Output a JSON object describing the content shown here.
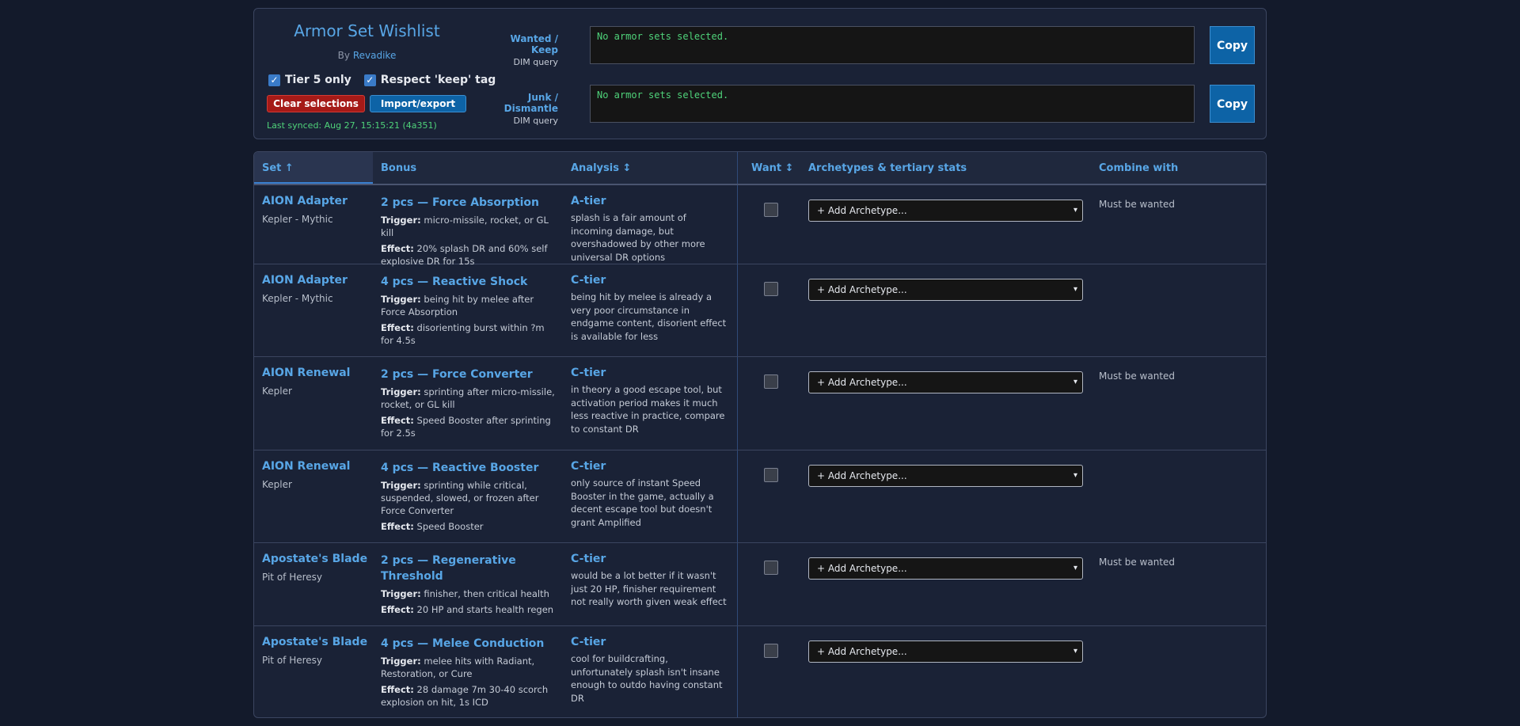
{
  "header": {
    "title": "Armor Set Wishlist",
    "by_prefix": "By",
    "author": "Revadike",
    "tier5_label": "Tier 5 only",
    "keep_label": "Respect 'keep' tag",
    "clear_label": "Clear selections",
    "import_label": "Import/export",
    "synced": "Last synced: Aug 27, 15:15:21 (4a351)"
  },
  "queries": {
    "wanted_label": "Wanted / Keep",
    "wanted_sub": "DIM query",
    "wanted_value": "No armor sets selected.",
    "junk_label": "Junk / Dismantle",
    "junk_sub": "DIM query",
    "junk_value": "No armor sets selected.",
    "copy_label": "Copy"
  },
  "columns": {
    "set": "Set ↑",
    "bonus": "Bonus",
    "analysis": "Analysis ↕",
    "want": "Want ↕",
    "archetypes": "Archetypes & tertiary stats",
    "combine": "Combine with"
  },
  "select_label": "+ Add Archetype...",
  "rows": [
    {
      "set": "AION Adapter",
      "source": "Kepler - Mythic",
      "bonus": "2 pcs — Force Absorption",
      "trigger_label": "Trigger:",
      "trigger": "micro-missile, rocket, or GL kill",
      "effect_label": "Effect:",
      "effect": "20% splash DR and 60% self explosive DR for 15s",
      "tier": "A-tier",
      "analysis": "splash is a fair amount of incoming damage, but overshadowed by other more universal DR options",
      "combine": "Must be wanted"
    },
    {
      "set": "AION Adapter",
      "source": "Kepler - Mythic",
      "bonus": "4 pcs — Reactive Shock",
      "trigger_label": "Trigger:",
      "trigger": "being hit by melee after Force Absorption",
      "effect_label": "Effect:",
      "effect": "disorienting burst within ?m for 4.5s",
      "tier": "C-tier",
      "analysis": "being hit by melee is already a very poor circumstance in endgame content, disorient effect is available for less",
      "combine": ""
    },
    {
      "set": "AION Renewal",
      "source": "Kepler",
      "bonus": "2 pcs — Force Converter",
      "trigger_label": "Trigger:",
      "trigger": "sprinting after micro-missile, rocket, or GL kill",
      "effect_label": "Effect:",
      "effect": "Speed Booster after sprinting for 2.5s",
      "tier": "C-tier",
      "analysis": "in theory a good escape tool, but activation period makes it much less reactive in practice, compare to constant DR",
      "combine": "Must be wanted"
    },
    {
      "set": "AION Renewal",
      "source": "Kepler",
      "bonus": "4 pcs — Reactive Booster",
      "trigger_label": "Trigger:",
      "trigger": "sprinting while critical, suspended, slowed, or frozen after Force Converter",
      "effect_label": "Effect:",
      "effect": "Speed Booster",
      "tier": "C-tier",
      "analysis": "only source of instant Speed Booster in the game, actually a decent escape tool but doesn't grant Amplified",
      "combine": ""
    },
    {
      "set": "Apostate's Blade",
      "source": "Pit of Heresy",
      "bonus": "2 pcs — Regenerative Threshold",
      "trigger_label": "Trigger:",
      "trigger": "finisher, then critical health",
      "effect_label": "Effect:",
      "effect": "20 HP and starts health regen",
      "tier": "C-tier",
      "analysis": "would be a lot better if it wasn't just 20 HP, finisher requirement not really worth given weak effect",
      "combine": "Must be wanted"
    },
    {
      "set": "Apostate's Blade",
      "source": "Pit of Heresy",
      "bonus": "4 pcs — Melee Conduction",
      "trigger_label": "Trigger:",
      "trigger": "melee hits with Radiant, Restoration, or Cure",
      "effect_label": "Effect:",
      "effect": "28 damage 7m 30-40 scorch explosion on hit, 1s ICD",
      "tier": "C-tier",
      "analysis": "cool for buildcrafting, unfortunately splash isn't insane enough to outdo having constant DR",
      "combine": ""
    }
  ]
}
